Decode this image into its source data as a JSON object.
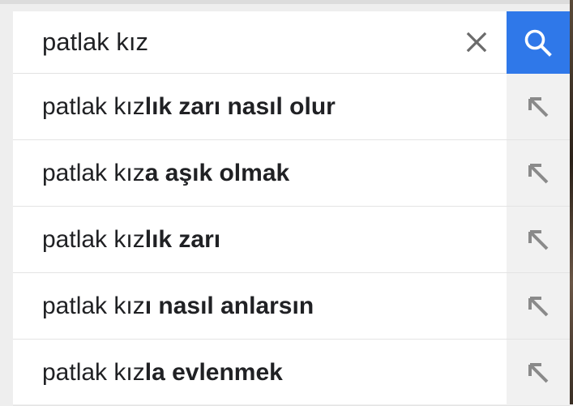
{
  "search": {
    "query": "patlak kız",
    "clear_icon": "close-icon",
    "submit_icon": "search-icon",
    "accent_color": "#2f78e9"
  },
  "suggestions": [
    {
      "typed": "patlak kız",
      "completion": "lık zarı nasıl olur"
    },
    {
      "typed": "patlak kız",
      "completion": "a aşık olmak"
    },
    {
      "typed": "patlak kız",
      "completion": "lık zarı"
    },
    {
      "typed": "patlak kız",
      "completion": "ı nasıl anlarsın"
    },
    {
      "typed": "patlak kız",
      "completion": "la evlenmek"
    }
  ],
  "fill_icon": "arrow-up-left-icon"
}
